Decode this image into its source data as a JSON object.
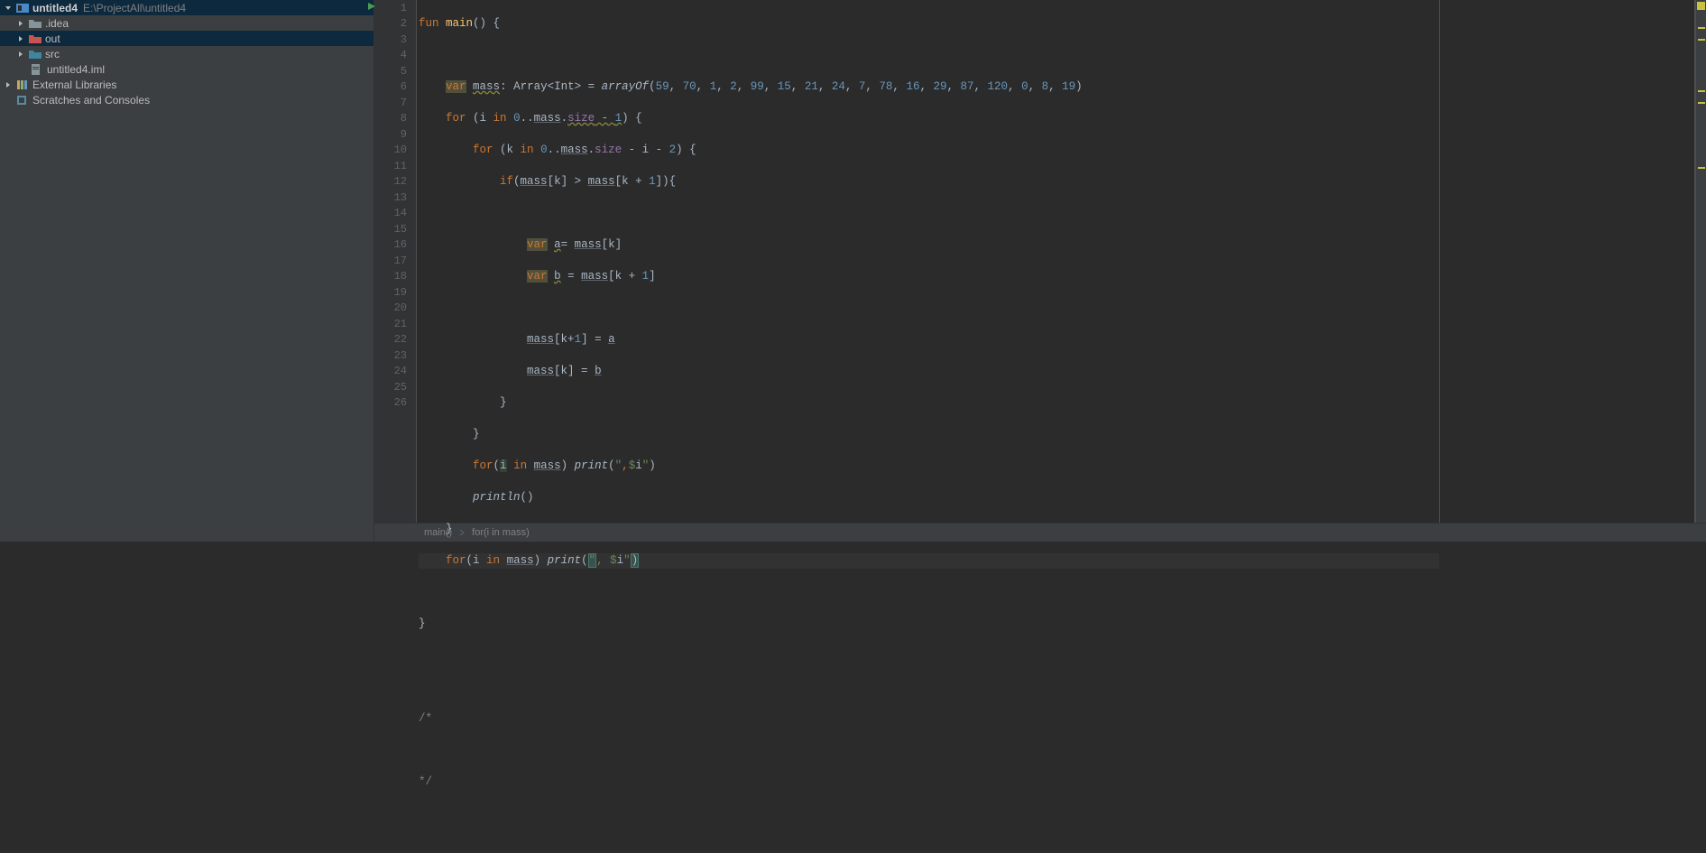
{
  "project": {
    "root_name": "untitled4",
    "root_path": "E:\\ProjectAll\\untitled4",
    "items": [
      {
        "name": ".idea",
        "type": "folder",
        "color": "grey"
      },
      {
        "name": "out",
        "type": "folder",
        "color": "orange"
      },
      {
        "name": "src",
        "type": "folder",
        "color": "blue"
      },
      {
        "name": "untitled4.iml",
        "type": "file"
      }
    ],
    "ext_lib": "External Libraries",
    "scratches": "Scratches and Consoles"
  },
  "code": {
    "lines": 26
  },
  "breadcrumb": {
    "item1": "main()",
    "item2": "for(i in mass)"
  },
  "chart_data": {
    "note": "not a chart"
  }
}
